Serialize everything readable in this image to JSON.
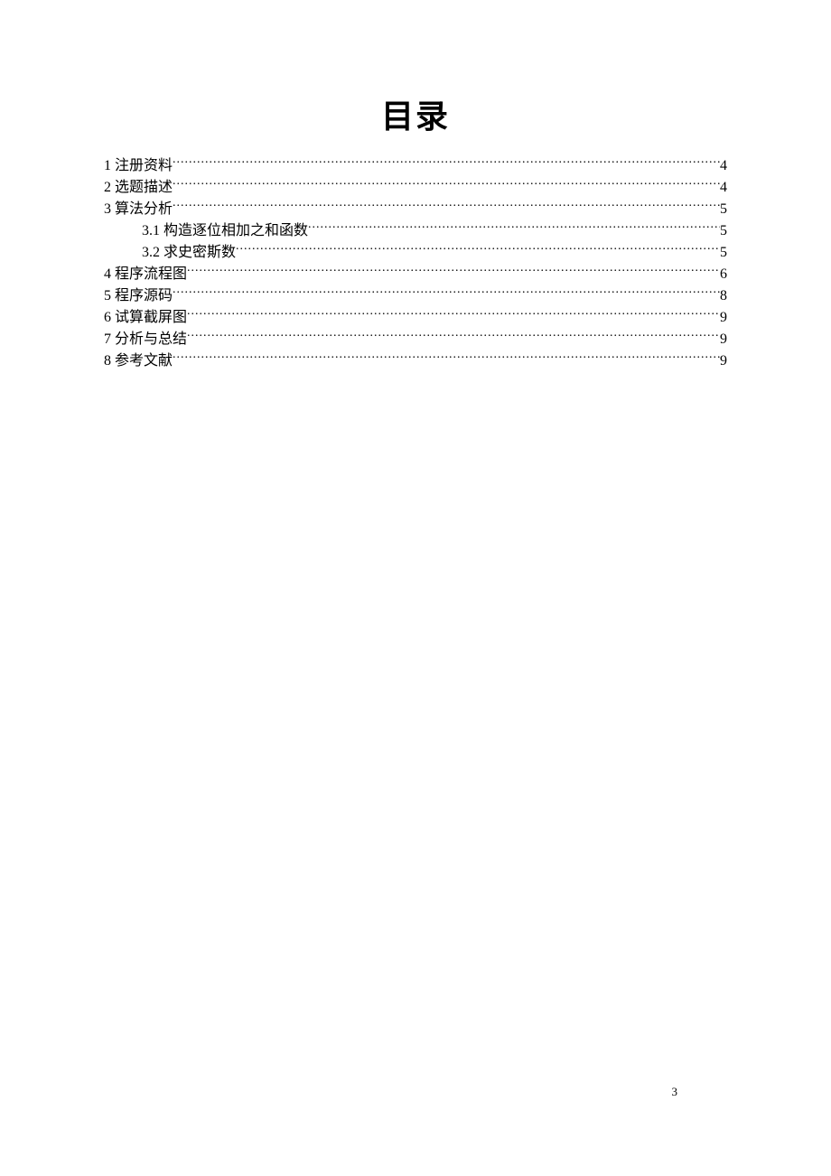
{
  "title": "目录",
  "toc": [
    {
      "label": "1 注册资料",
      "page": "4",
      "indent": false
    },
    {
      "label": "2 选题描述",
      "page": "4",
      "indent": false
    },
    {
      "label": "3 算法分析",
      "page": "5",
      "indent": false
    },
    {
      "label": "3.1 构造逐位相加之和函数",
      "page": "5",
      "indent": true
    },
    {
      "label": "3.2 求史密斯数",
      "page": "5",
      "indent": true
    },
    {
      "label": "4 程序流程图",
      "page": "6",
      "indent": false
    },
    {
      "label": "5 程序源码",
      "page": "8",
      "indent": false
    },
    {
      "label": "6 试算截屏图",
      "page": "9",
      "indent": false
    },
    {
      "label": "7 分析与总结",
      "page": "9",
      "indent": false
    },
    {
      "label": "8 参考文献",
      "page": "9",
      "indent": false
    }
  ],
  "pageNumber": "3"
}
